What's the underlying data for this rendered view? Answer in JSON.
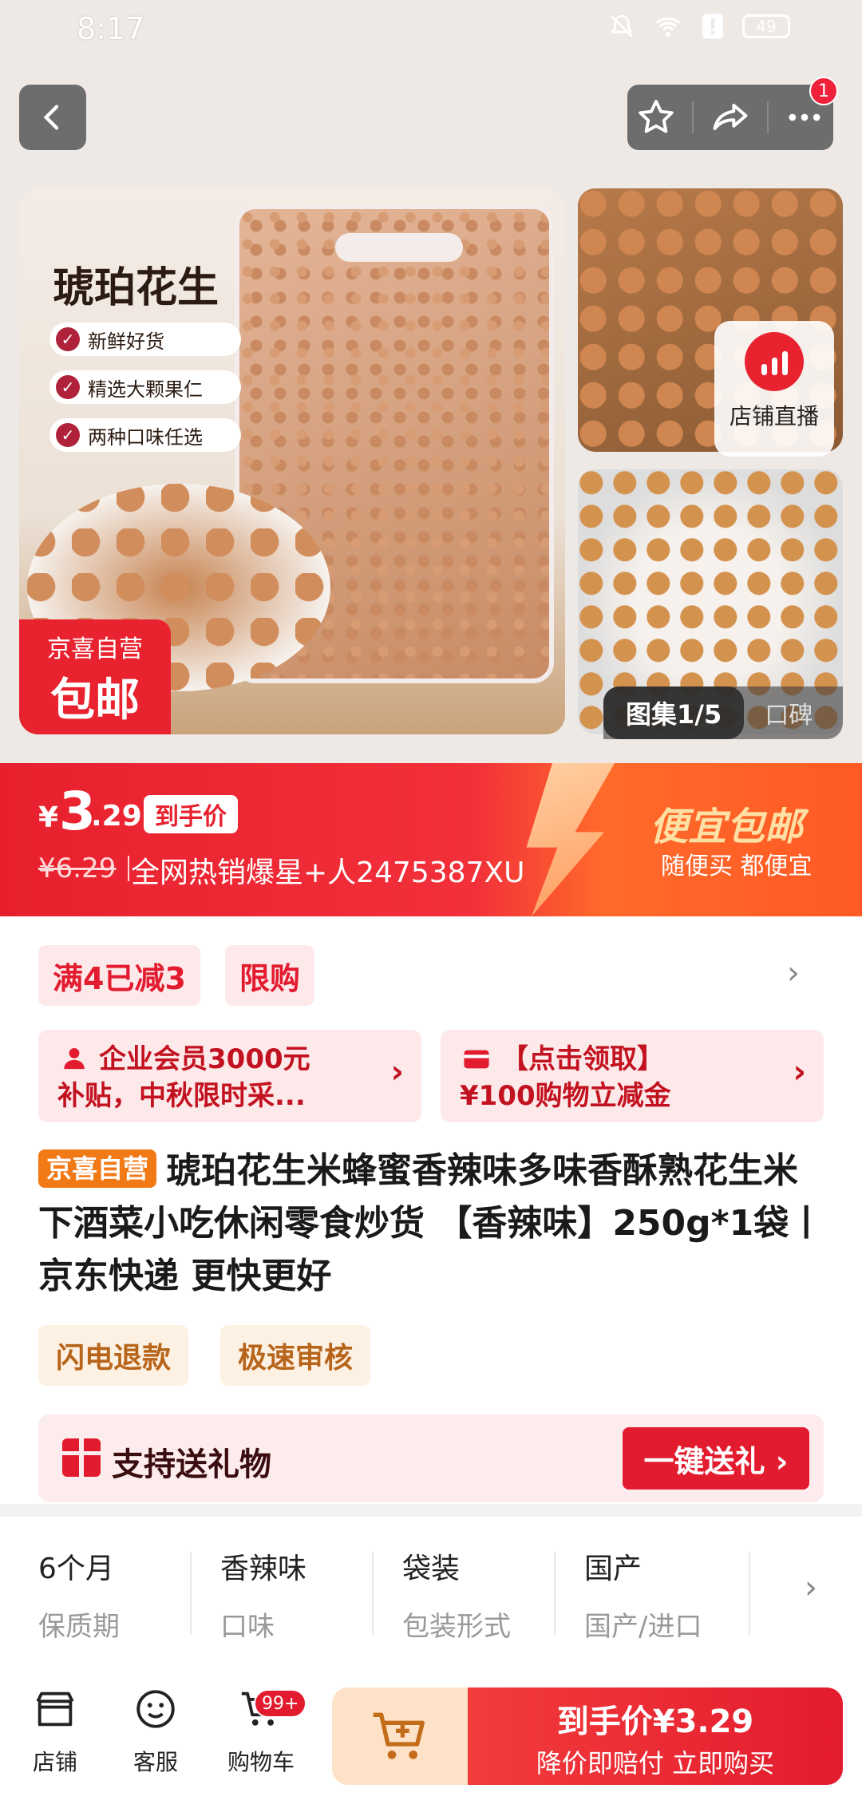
{
  "status_bar": {
    "time": "8:17",
    "battery": "49"
  },
  "nav": {
    "notification_count": "1"
  },
  "gallery": {
    "product_name": "琥珀花生",
    "features": [
      "新鲜好货",
      "精选大颗果仁",
      "两种口味任选"
    ],
    "badge_line1": "京喜自营",
    "badge_line2": "包邮",
    "live_label": "店铺直播",
    "tab_active": "图集1/5",
    "tab_inactive": "口碑"
  },
  "price": {
    "currency": "¥",
    "integer": "3",
    "decimal": ".29",
    "tag": "到手价",
    "original": "¥6.29",
    "hot_text": "全网热销爆星+人2475387XU",
    "promo_title": "便宜包邮",
    "promo_sub": "随便买 都便宜"
  },
  "promos": {
    "chip1": "满4已减3",
    "chip2": "限购",
    "coupon1_line1": "企业会员3000元",
    "coupon1_line2": "补贴，中秋限时采...",
    "coupon2_line1": "【点击领取】",
    "coupon2_line2": "¥100购物立减金"
  },
  "product": {
    "self_tag": "京喜自营",
    "title": "琥珀花生米蜂蜜香辣味多味香酥熟花生米下酒菜小吃休闲零食炒货 【香辣味】250g*1袋丨京东快递 更快更好",
    "service1": "闪电退款",
    "service2": "极速审核",
    "gift_text": "支持送礼物",
    "gift_button": "一键送礼 ›"
  },
  "specs": [
    {
      "value": "6个月",
      "key": "保质期"
    },
    {
      "value": "香辣味",
      "key": "口味"
    },
    {
      "value": "袋装",
      "key": "包装形式"
    },
    {
      "value": "国产",
      "key": "国产/进口"
    }
  ],
  "bottom_bar": {
    "store": "店铺",
    "service": "客服",
    "cart": "购物车",
    "cart_badge": "99+",
    "buy_line1": "到手价¥3.29",
    "buy_line2": "降价即赔付 立即购买"
  },
  "colors": {
    "brand_red": "#e31b2e",
    "orange": "#f27a16",
    "promo_gold": "#ffe0a4"
  }
}
